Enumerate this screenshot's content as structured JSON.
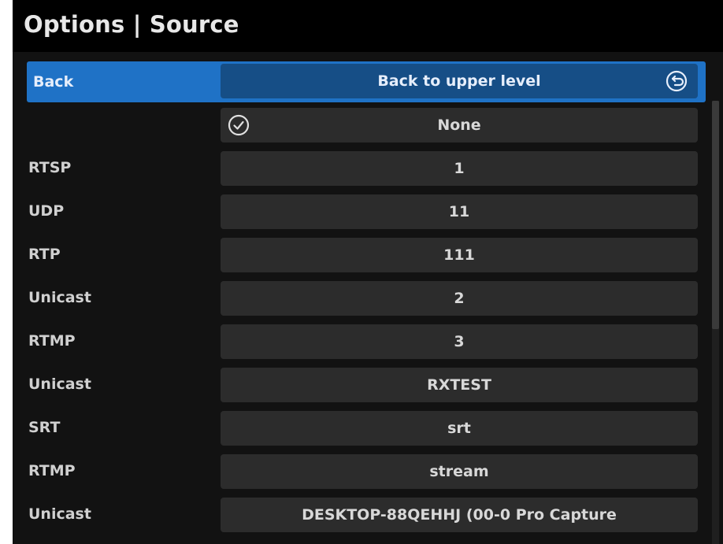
{
  "window": {
    "title": "Options | Source"
  },
  "back_row": {
    "label": "Back",
    "value": "Back to upper level",
    "icon": "back-arrow-icon"
  },
  "none_row": {
    "label": "",
    "value": "None",
    "icon": "check-circle-icon",
    "checked": true
  },
  "sources": [
    {
      "label": "RTSP",
      "value": "1"
    },
    {
      "label": "UDP",
      "value": "11"
    },
    {
      "label": "RTP",
      "value": "111"
    },
    {
      "label": "Unicast",
      "value": "2"
    },
    {
      "label": "RTMP",
      "value": "3"
    },
    {
      "label": "Unicast",
      "value": "RXTEST"
    },
    {
      "label": "SRT",
      "value": "srt"
    },
    {
      "label": "RTMP",
      "value": "stream"
    },
    {
      "label": "Unicast",
      "value": "DESKTOP-88QEHHJ (00-0 Pro Capture"
    }
  ],
  "colors": {
    "accent": "#1f72c6",
    "background": "#121212",
    "titlebar": "#000000",
    "cell": "#2c2c2c"
  }
}
